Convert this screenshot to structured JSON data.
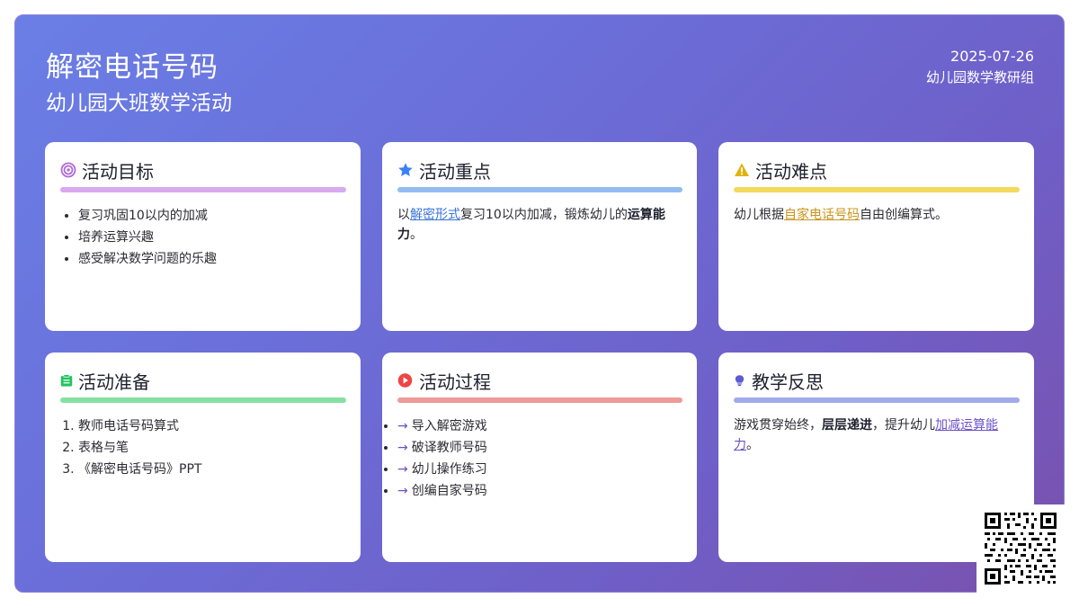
{
  "header": {
    "title": "解密电话号码",
    "subtitle": "幼儿园大班数学活动",
    "date": "2025-07-26",
    "org": "幼儿园数学教研组"
  },
  "colors": {
    "goal": "#b06bd6",
    "key": "#3b82f6",
    "difficulty": "#e0b30f",
    "prep": "#22c55e",
    "process": "#ef4444",
    "reflection": "#5b5bd6"
  },
  "cards": {
    "goal": {
      "icon": "target-icon",
      "title": "活动目标",
      "items": [
        "复习巩固10以内的加减",
        "培养运算兴趣",
        "感受解决数学问题的乐趣"
      ]
    },
    "key": {
      "icon": "star-icon",
      "title": "活动重点",
      "text_pre": "以",
      "link": "解密形式",
      "text_mid": "复习10以内加减，锻炼幼儿的",
      "bold": "运算能力",
      "text_post": "。"
    },
    "difficulty": {
      "icon": "warning-icon",
      "title": "活动难点",
      "text_pre": "幼儿根据",
      "link": "自家电话号码",
      "text_post": "自由创编算式。"
    },
    "prep": {
      "icon": "clipboard-icon",
      "title": "活动准备",
      "items": [
        "教师电话号码算式",
        "表格与笔",
        "《解密电话号码》PPT"
      ]
    },
    "process": {
      "icon": "play-icon",
      "title": "活动过程",
      "arrow": "→",
      "items": [
        "导入解密游戏",
        "破译教师号码",
        "幼儿操作练习",
        "创编自家号码"
      ]
    },
    "reflection": {
      "icon": "lightbulb-icon",
      "title": "教学反思",
      "text_pre": "游戏贯穿始终，",
      "bold": "层层递进",
      "text_mid": "，提升幼儿",
      "link": "加减运算能力",
      "text_post": "。"
    }
  }
}
